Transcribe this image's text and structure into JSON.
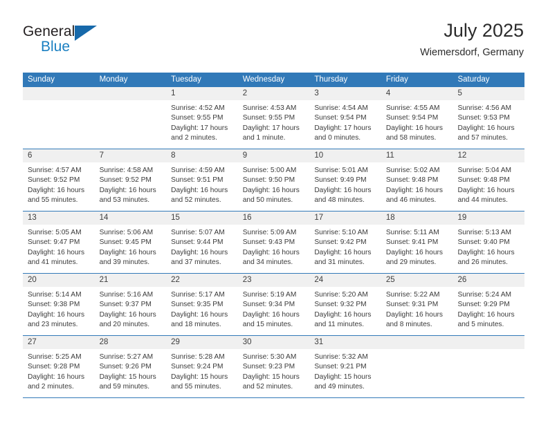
{
  "logo": {
    "word_one": "General",
    "word_two": "Blue",
    "triangle_color": "#1769aa"
  },
  "header": {
    "title": "July 2025",
    "subtitle": "Wiemersdorf, Germany"
  },
  "theme": {
    "header_blue": "#3179b8",
    "day_band_gray": "#f0f0f0",
    "text": "#3a3a3a"
  },
  "weekdays": [
    "Sunday",
    "Monday",
    "Tuesday",
    "Wednesday",
    "Thursday",
    "Friday",
    "Saturday"
  ],
  "weeks": [
    [
      {
        "day": "",
        "sunrise": "",
        "sunset": "",
        "daylight_line1": "",
        "daylight_line2": ""
      },
      {
        "day": "",
        "sunrise": "",
        "sunset": "",
        "daylight_line1": "",
        "daylight_line2": ""
      },
      {
        "day": "1",
        "sunrise": "Sunrise: 4:52 AM",
        "sunset": "Sunset: 9:55 PM",
        "daylight_line1": "Daylight: 17 hours",
        "daylight_line2": "and 2 minutes."
      },
      {
        "day": "2",
        "sunrise": "Sunrise: 4:53 AM",
        "sunset": "Sunset: 9:55 PM",
        "daylight_line1": "Daylight: 17 hours",
        "daylight_line2": "and 1 minute."
      },
      {
        "day": "3",
        "sunrise": "Sunrise: 4:54 AM",
        "sunset": "Sunset: 9:54 PM",
        "daylight_line1": "Daylight: 17 hours",
        "daylight_line2": "and 0 minutes."
      },
      {
        "day": "4",
        "sunrise": "Sunrise: 4:55 AM",
        "sunset": "Sunset: 9:54 PM",
        "daylight_line1": "Daylight: 16 hours",
        "daylight_line2": "and 58 minutes."
      },
      {
        "day": "5",
        "sunrise": "Sunrise: 4:56 AM",
        "sunset": "Sunset: 9:53 PM",
        "daylight_line1": "Daylight: 16 hours",
        "daylight_line2": "and 57 minutes."
      }
    ],
    [
      {
        "day": "6",
        "sunrise": "Sunrise: 4:57 AM",
        "sunset": "Sunset: 9:52 PM",
        "daylight_line1": "Daylight: 16 hours",
        "daylight_line2": "and 55 minutes."
      },
      {
        "day": "7",
        "sunrise": "Sunrise: 4:58 AM",
        "sunset": "Sunset: 9:52 PM",
        "daylight_line1": "Daylight: 16 hours",
        "daylight_line2": "and 53 minutes."
      },
      {
        "day": "8",
        "sunrise": "Sunrise: 4:59 AM",
        "sunset": "Sunset: 9:51 PM",
        "daylight_line1": "Daylight: 16 hours",
        "daylight_line2": "and 52 minutes."
      },
      {
        "day": "9",
        "sunrise": "Sunrise: 5:00 AM",
        "sunset": "Sunset: 9:50 PM",
        "daylight_line1": "Daylight: 16 hours",
        "daylight_line2": "and 50 minutes."
      },
      {
        "day": "10",
        "sunrise": "Sunrise: 5:01 AM",
        "sunset": "Sunset: 9:49 PM",
        "daylight_line1": "Daylight: 16 hours",
        "daylight_line2": "and 48 minutes."
      },
      {
        "day": "11",
        "sunrise": "Sunrise: 5:02 AM",
        "sunset": "Sunset: 9:48 PM",
        "daylight_line1": "Daylight: 16 hours",
        "daylight_line2": "and 46 minutes."
      },
      {
        "day": "12",
        "sunrise": "Sunrise: 5:04 AM",
        "sunset": "Sunset: 9:48 PM",
        "daylight_line1": "Daylight: 16 hours",
        "daylight_line2": "and 44 minutes."
      }
    ],
    [
      {
        "day": "13",
        "sunrise": "Sunrise: 5:05 AM",
        "sunset": "Sunset: 9:47 PM",
        "daylight_line1": "Daylight: 16 hours",
        "daylight_line2": "and 41 minutes."
      },
      {
        "day": "14",
        "sunrise": "Sunrise: 5:06 AM",
        "sunset": "Sunset: 9:45 PM",
        "daylight_line1": "Daylight: 16 hours",
        "daylight_line2": "and 39 minutes."
      },
      {
        "day": "15",
        "sunrise": "Sunrise: 5:07 AM",
        "sunset": "Sunset: 9:44 PM",
        "daylight_line1": "Daylight: 16 hours",
        "daylight_line2": "and 37 minutes."
      },
      {
        "day": "16",
        "sunrise": "Sunrise: 5:09 AM",
        "sunset": "Sunset: 9:43 PM",
        "daylight_line1": "Daylight: 16 hours",
        "daylight_line2": "and 34 minutes."
      },
      {
        "day": "17",
        "sunrise": "Sunrise: 5:10 AM",
        "sunset": "Sunset: 9:42 PM",
        "daylight_line1": "Daylight: 16 hours",
        "daylight_line2": "and 31 minutes."
      },
      {
        "day": "18",
        "sunrise": "Sunrise: 5:11 AM",
        "sunset": "Sunset: 9:41 PM",
        "daylight_line1": "Daylight: 16 hours",
        "daylight_line2": "and 29 minutes."
      },
      {
        "day": "19",
        "sunrise": "Sunrise: 5:13 AM",
        "sunset": "Sunset: 9:40 PM",
        "daylight_line1": "Daylight: 16 hours",
        "daylight_line2": "and 26 minutes."
      }
    ],
    [
      {
        "day": "20",
        "sunrise": "Sunrise: 5:14 AM",
        "sunset": "Sunset: 9:38 PM",
        "daylight_line1": "Daylight: 16 hours",
        "daylight_line2": "and 23 minutes."
      },
      {
        "day": "21",
        "sunrise": "Sunrise: 5:16 AM",
        "sunset": "Sunset: 9:37 PM",
        "daylight_line1": "Daylight: 16 hours",
        "daylight_line2": "and 20 minutes."
      },
      {
        "day": "22",
        "sunrise": "Sunrise: 5:17 AM",
        "sunset": "Sunset: 9:35 PM",
        "daylight_line1": "Daylight: 16 hours",
        "daylight_line2": "and 18 minutes."
      },
      {
        "day": "23",
        "sunrise": "Sunrise: 5:19 AM",
        "sunset": "Sunset: 9:34 PM",
        "daylight_line1": "Daylight: 16 hours",
        "daylight_line2": "and 15 minutes."
      },
      {
        "day": "24",
        "sunrise": "Sunrise: 5:20 AM",
        "sunset": "Sunset: 9:32 PM",
        "daylight_line1": "Daylight: 16 hours",
        "daylight_line2": "and 11 minutes."
      },
      {
        "day": "25",
        "sunrise": "Sunrise: 5:22 AM",
        "sunset": "Sunset: 9:31 PM",
        "daylight_line1": "Daylight: 16 hours",
        "daylight_line2": "and 8 minutes."
      },
      {
        "day": "26",
        "sunrise": "Sunrise: 5:24 AM",
        "sunset": "Sunset: 9:29 PM",
        "daylight_line1": "Daylight: 16 hours",
        "daylight_line2": "and 5 minutes."
      }
    ],
    [
      {
        "day": "27",
        "sunrise": "Sunrise: 5:25 AM",
        "sunset": "Sunset: 9:28 PM",
        "daylight_line1": "Daylight: 16 hours",
        "daylight_line2": "and 2 minutes."
      },
      {
        "day": "28",
        "sunrise": "Sunrise: 5:27 AM",
        "sunset": "Sunset: 9:26 PM",
        "daylight_line1": "Daylight: 15 hours",
        "daylight_line2": "and 59 minutes."
      },
      {
        "day": "29",
        "sunrise": "Sunrise: 5:28 AM",
        "sunset": "Sunset: 9:24 PM",
        "daylight_line1": "Daylight: 15 hours",
        "daylight_line2": "and 55 minutes."
      },
      {
        "day": "30",
        "sunrise": "Sunrise: 5:30 AM",
        "sunset": "Sunset: 9:23 PM",
        "daylight_line1": "Daylight: 15 hours",
        "daylight_line2": "and 52 minutes."
      },
      {
        "day": "31",
        "sunrise": "Sunrise: 5:32 AM",
        "sunset": "Sunset: 9:21 PM",
        "daylight_line1": "Daylight: 15 hours",
        "daylight_line2": "and 49 minutes."
      },
      {
        "day": "",
        "sunrise": "",
        "sunset": "",
        "daylight_line1": "",
        "daylight_line2": ""
      },
      {
        "day": "",
        "sunrise": "",
        "sunset": "",
        "daylight_line1": "",
        "daylight_line2": ""
      }
    ]
  ]
}
